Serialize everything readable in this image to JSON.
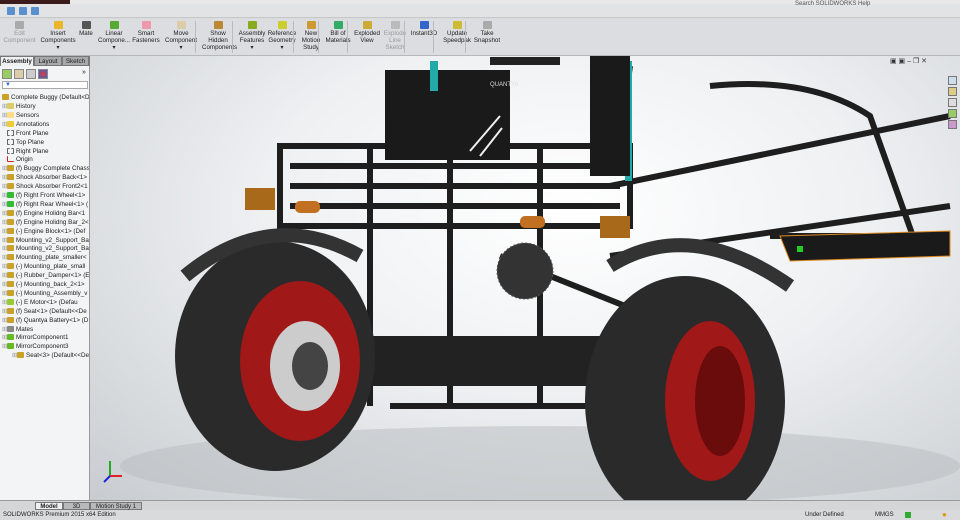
{
  "app": {
    "search_placeholder": "Search SOLIDWORKS Help"
  },
  "ribbon": {
    "buttons": [
      {
        "label": "Edit Component",
        "icon": "edit-component-icon",
        "disabled": true
      },
      {
        "label": "Insert Components",
        "icon": "insert-components-icon",
        "dropdown": true
      },
      {
        "label": "Mate",
        "icon": "mate-icon"
      },
      {
        "label": "Linear Compone...",
        "icon": "linear-pattern-icon",
        "dropdown": true
      },
      {
        "label": "Smart Fasteners",
        "icon": "smart-fasteners-icon"
      },
      {
        "label": "Move Component",
        "icon": "move-component-icon",
        "dropdown": true
      },
      {
        "label": "Show Hidden Components",
        "icon": "show-hidden-icon"
      },
      {
        "label": "Assembly Features",
        "icon": "assembly-features-icon",
        "dropdown": true
      },
      {
        "label": "Reference Geometry",
        "icon": "reference-geometry-icon",
        "dropdown": true
      },
      {
        "label": "New Motion Study",
        "icon": "motion-study-icon"
      },
      {
        "label": "Bill of Materials",
        "icon": "bom-icon"
      },
      {
        "label": "Exploded View",
        "icon": "exploded-view-icon"
      },
      {
        "label": "Explode Line Sketch",
        "icon": "explode-line-icon",
        "disabled": true
      },
      {
        "label": "Instant3D",
        "icon": "instant3d-icon"
      },
      {
        "label": "Update Speedpak",
        "icon": "speedpak-icon"
      },
      {
        "label": "Take Snapshot",
        "icon": "snapshot-icon"
      }
    ]
  },
  "tabs": [
    "Assembly",
    "Layout",
    "Sketch",
    "Evaluate",
    "Render Tools",
    "SOLIDWORKS Add-Ins",
    "SOLIDWORKS MBD"
  ],
  "active_tab": "Assembly",
  "tree": {
    "root": "Complete Buggy  (Default<D",
    "items": [
      {
        "label": "History",
        "icon": "history-icon"
      },
      {
        "label": "Sensors",
        "icon": "sensors-icon"
      },
      {
        "label": "Annotations",
        "icon": "annotations-icon"
      },
      {
        "label": "Front Plane",
        "icon": "plane-icon"
      },
      {
        "label": "Top Plane",
        "icon": "plane-icon"
      },
      {
        "label": "Right Plane",
        "icon": "plane-icon"
      },
      {
        "label": "Origin",
        "icon": "origin-icon"
      },
      {
        "label": "(f) Buggy Complete Chass",
        "icon": "part-icon"
      },
      {
        "label": "Shock Absorber Back<1>",
        "icon": "part-icon"
      },
      {
        "label": "Shock Absorber Front2<1",
        "icon": "part-icon"
      },
      {
        "label": "(f) Right Front Wheel<1>",
        "icon": "part-green-icon"
      },
      {
        "label": "(f) Right Rear Wheel<1>  (",
        "icon": "part-green-icon"
      },
      {
        "label": "(f) Engine Holidng Bar<1",
        "icon": "part-icon"
      },
      {
        "label": "(f) Engine Holidng Bar_2<",
        "icon": "part-icon"
      },
      {
        "label": "(-) Engine Block<1> (Def",
        "icon": "part-icon"
      },
      {
        "label": "Mounting_v2_Support_Ba",
        "icon": "part-icon"
      },
      {
        "label": "Mounting_v2_Support_Ba",
        "icon": "part-icon"
      },
      {
        "label": "Mounting_plate_smaller<",
        "icon": "part-icon"
      },
      {
        "label": "(-) Mounting_plate_small",
        "icon": "part-icon"
      },
      {
        "label": "(-) Rubber_Damper<1> (E",
        "icon": "part-icon"
      },
      {
        "label": "(-) Mounting_back_2<1>",
        "icon": "part-icon"
      },
      {
        "label": "(-) Mounting_Assembly_v",
        "icon": "part-icon"
      },
      {
        "label": "(-) E Motor<1> (Defau",
        "icon": "assembly-icon"
      },
      {
        "label": "(f) Seat<1> (Default<<De",
        "icon": "part-icon"
      },
      {
        "label": "(f) Quantya Battery<1> (D",
        "icon": "part-icon"
      },
      {
        "label": "Mates",
        "icon": "mates-icon"
      },
      {
        "label": "MirrorComponent1",
        "icon": "mirror-icon"
      },
      {
        "label": "MirrorComponent3",
        "icon": "mirror-icon"
      },
      {
        "label": "Seat<3> (Default<<De",
        "icon": "part-icon",
        "indent": true
      }
    ]
  },
  "viewport": {
    "model_label": "QUANTYA"
  },
  "bottom_tabs": [
    "Model",
    "3D Views",
    "Motion Study 1"
  ],
  "status": {
    "edition": "SOLIDWORKS Premium 2015 x64 Edition",
    "state": "Under Defined",
    "units": "MMGS"
  },
  "colors": {
    "rim_red": "#a01818",
    "tire": "#2a2a2a",
    "frame": "#1e1e1e",
    "accent_orange": "#e08a20"
  }
}
